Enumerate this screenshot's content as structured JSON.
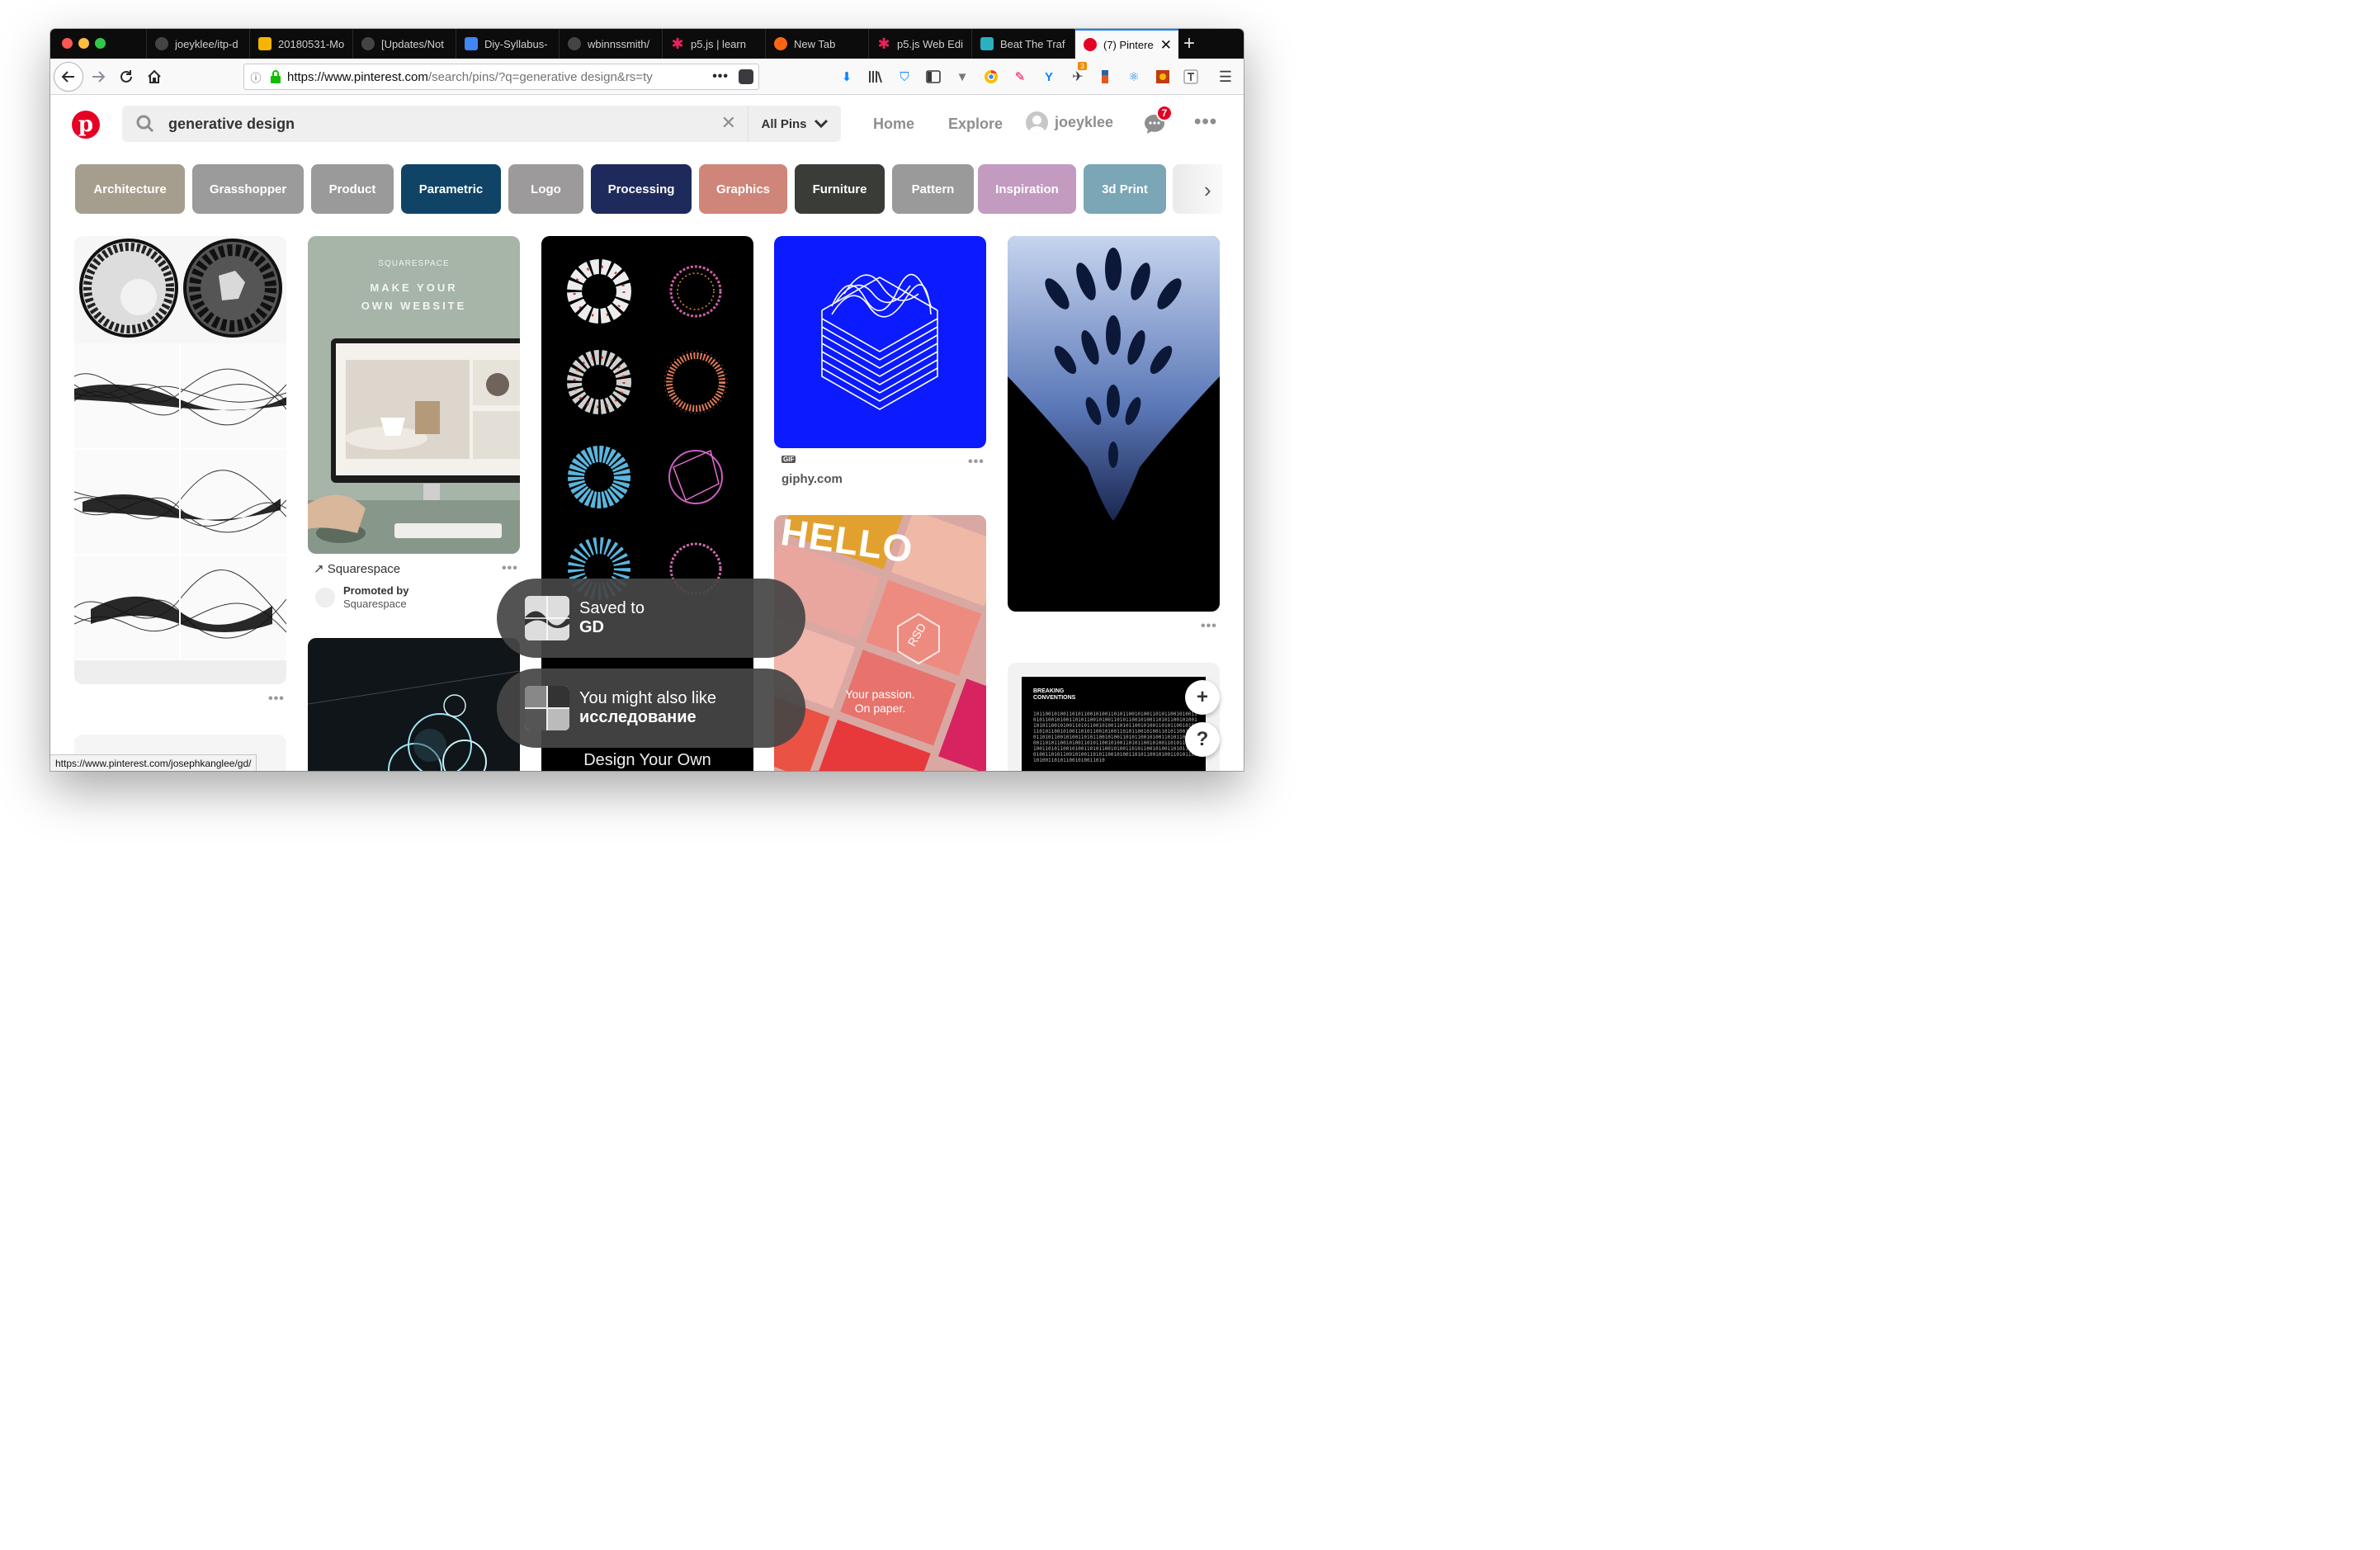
{
  "browser": {
    "tabs": [
      {
        "label": "joeyklee/itp-d",
        "icon": "github-icon",
        "color": "#444444"
      },
      {
        "label": "20180531-Mo",
        "icon": "slides-icon",
        "color": "#f4b400"
      },
      {
        "label": "[Updates/Not",
        "icon": "github-icon",
        "color": "#444444"
      },
      {
        "label": "Diy-Syllabus-",
        "icon": "docs-icon",
        "color": "#4285f4"
      },
      {
        "label": "wbinnssmith/",
        "icon": "github-icon",
        "color": "#444444"
      },
      {
        "label": "p5.js | learn",
        "icon": "p5-asterisk-icon",
        "color": "#ed225d"
      },
      {
        "label": "New Tab",
        "icon": "firefox-icon",
        "color": "#ff6611"
      },
      {
        "label": "p5.js Web Edi",
        "icon": "p5-asterisk-icon",
        "color": "#ed225d"
      },
      {
        "label": "Beat The Traf",
        "icon": "link-icon",
        "color": "#2ab0c0"
      },
      {
        "label": "(7) Pintere",
        "icon": "pinterest-icon",
        "color": "#e60023"
      }
    ],
    "new_tab": "+",
    "close_tab": "✕",
    "url_main": "https://www.pinterest.com",
    "url_path": "/search/pins/?q=generative design&rs=ty",
    "url_dots": "•••",
    "toolbar_badge": "3"
  },
  "pinterest": {
    "search_value": "generative design",
    "search_clear": "✕",
    "filter_label": "All Pins",
    "nav_home": "Home",
    "nav_explore": "Explore",
    "username": "joeyklee",
    "notif_count": "7",
    "more": "•••"
  },
  "guides": [
    {
      "label": "Architecture",
      "color": "#a59e8e"
    },
    {
      "label": "Grasshopper",
      "color": "#9b9b9b"
    },
    {
      "label": "Product",
      "color": "#9a9a9a"
    },
    {
      "label": "Parametric",
      "color": "#0f4466"
    },
    {
      "label": "Logo",
      "color": "#9c9a9a"
    },
    {
      "label": "Processing",
      "color": "#1f2a5c"
    },
    {
      "label": "Graphics",
      "color": "#cf857a"
    },
    {
      "label": "Furniture",
      "color": "#3a3c38"
    },
    {
      "label": "Pattern",
      "color": "#9a9a9a"
    },
    {
      "label": "Inspiration",
      "color": "#c39ac0"
    },
    {
      "label": "3d Print",
      "color": "#7aa6b6"
    }
  ],
  "pins": {
    "squarespace_brand": "SQUARESPACE",
    "squarespace_headline_1": "MAKE YOUR",
    "squarespace_headline_2": "OWN WEBSITE",
    "squarespace_link": "Squarespace",
    "promoted_by": "Promoted by",
    "promoter": "Squarespace",
    "giphy_badge": "GIF",
    "giphy_source": "giphy.com",
    "hello_text": "HELLO",
    "rsd_text": "RSD",
    "passion_1": "Your passion.",
    "passion_2": "On paper.",
    "wix_text": "Design Your Own",
    "breaking_1": "BREAKING",
    "breaking_2": "CONVENTIONS",
    "pin_more": "•••"
  },
  "toasts": {
    "saved_line": "Saved to",
    "saved_board": "GD",
    "also_like_line": "You might also like",
    "also_like_board": "исследование"
  },
  "fabs": {
    "add": "+",
    "help": "?"
  },
  "status_url": "https://www.pinterest.com/josephkanglee/gd/"
}
